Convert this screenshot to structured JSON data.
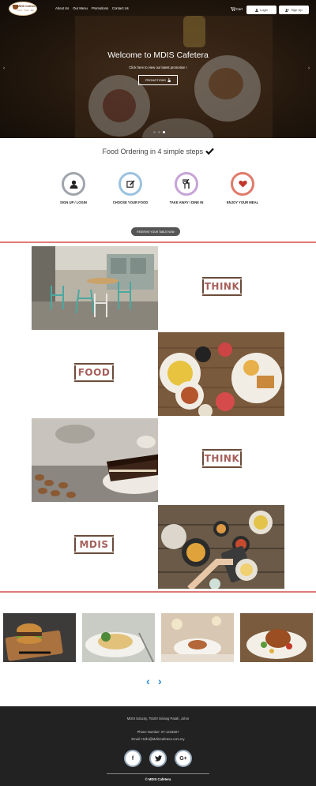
{
  "header": {
    "logo_name": "MDIS Cafetera",
    "logo_sub": "Food · Think · Eat",
    "nav": [
      "About Us",
      "Our Menu",
      "Promotions",
      "Contact Us"
    ],
    "cart": "Cart",
    "login": "Login",
    "signup": "Sign Up"
  },
  "hero": {
    "title": "Welcome to MDIS Cafetera",
    "subtitle": "Click here to view our latest promotion !",
    "button": "PROMOTIONS"
  },
  "steps": {
    "title": "Food Ordering in 4 simple steps",
    "items": [
      {
        "label": "SIGN UP / LOGIN",
        "icon": "user-icon",
        "color": "#a0a4ab"
      },
      {
        "label": "CHOOSE YOUR FOOD",
        "icon": "edit-icon",
        "color": "#9bc3e0"
      },
      {
        "label": "TAKE AWAY / DINE IN",
        "icon": "utensils-icon",
        "color": "#c7a3d6"
      },
      {
        "label": "ENJOY YOUR MEAL",
        "icon": "heart-icon",
        "color": "#e07a6a"
      }
    ],
    "reserve": "RESERVE YOUR TABLE NOW"
  },
  "grid": {
    "words": [
      "THINK",
      "FOOD",
      "THINK",
      "MDIS"
    ]
  },
  "footer": {
    "address": "MDIS Educity, 79100 Gelang Patah, Johor",
    "phone": "Phone Number: 07-1234567",
    "email": "Email: Hello@MdisCafetera.com.my",
    "copyright": "© MDIS Cafetera",
    "social": [
      "f",
      "t",
      "G+"
    ]
  },
  "colors": {
    "accent_red": "#e07a7a",
    "chevron_blue": "#2a8ae0",
    "footer_bg": "#222222"
  }
}
